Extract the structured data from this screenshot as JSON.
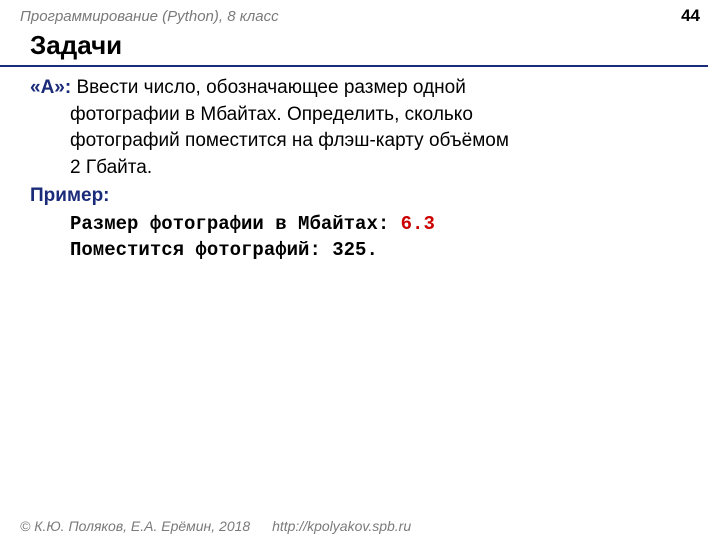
{
  "header": {
    "course": "Программирование (Python), 8 класс",
    "page": "44"
  },
  "title": "Задачи",
  "task": {
    "label": "«A»:",
    "line1": "Ввести число, обозначающее размер одной",
    "line2": "фотографии в Мбайтах. Определить, сколько",
    "line3": "фотографий поместится на флэш-карту объёмом",
    "line4": "2 Гбайта."
  },
  "example": {
    "label": "Пример:",
    "l1_prompt": "Размер фотографии в Мбайтах: ",
    "l1_input": "6.3",
    "l2": "Поместится фотографий: 325."
  },
  "footer": {
    "copyright": "© К.Ю. Поляков, Е.А. Ерёмин, 2018",
    "url": "http://kpolyakov.spb.ru"
  }
}
